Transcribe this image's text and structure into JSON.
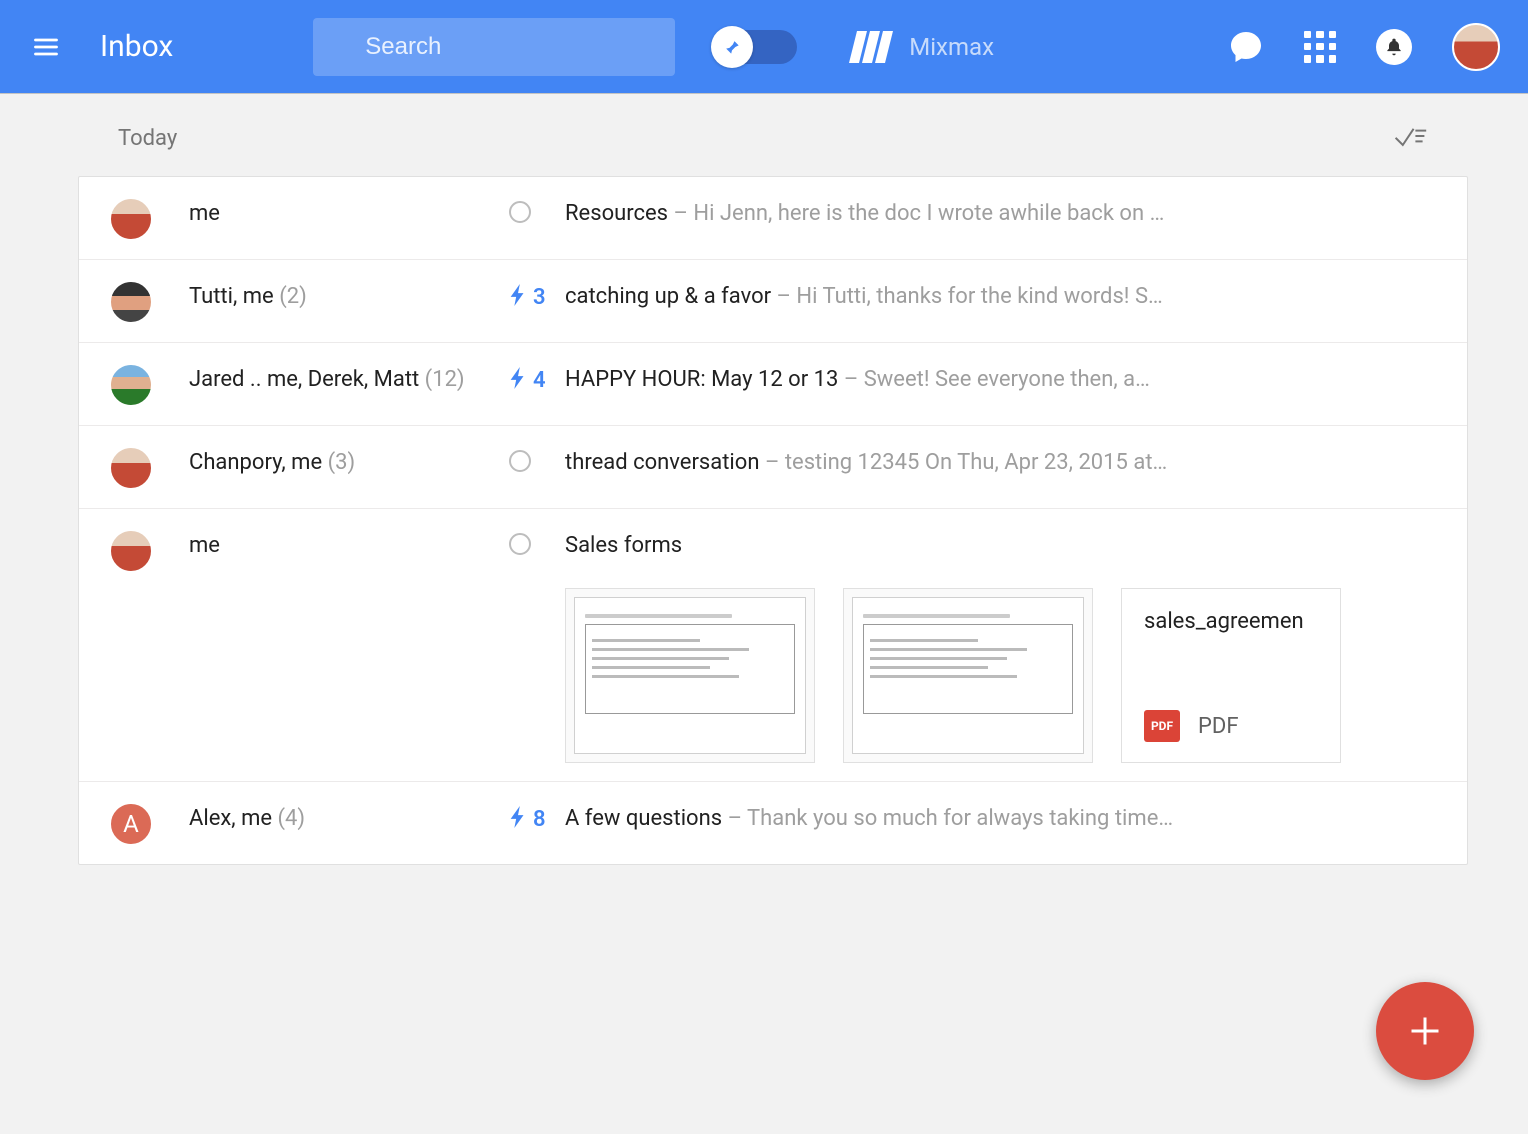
{
  "header": {
    "title": "Inbox",
    "search_placeholder": "Search",
    "mixmax_label": "Mixmax"
  },
  "section": {
    "label": "Today"
  },
  "threads": [
    {
      "sender": "me",
      "count": "",
      "indicator": "circle",
      "subject": "Resources",
      "snippet": " – Hi Jenn, here is the doc I wrote awhile back on …",
      "avatar": "me"
    },
    {
      "sender": "Tutti, me",
      "count": " (2)",
      "indicator": "bolt",
      "bolt_count": "3",
      "subject": "catching up & a favor",
      "snippet": " – Hi Tutti, thanks for the kind words! S…",
      "avatar": "a2"
    },
    {
      "sender": "Jared .. me, Derek, Matt",
      "count": " (12)",
      "indicator": "bolt",
      "bolt_count": "4",
      "subject": "HAPPY HOUR: May 12 or 13",
      "snippet": " – Sweet! See everyone then, a…",
      "avatar": "a3"
    },
    {
      "sender": "Chanpory, me",
      "count": " (3)",
      "indicator": "circle",
      "subject": "thread conversation",
      "snippet": " – testing 12345 On Thu, Apr 23, 2015 at…",
      "avatar": "me"
    },
    {
      "sender": "me",
      "count": "",
      "indicator": "circle",
      "subject": "Sales forms",
      "snippet": "",
      "avatar": "me",
      "attachments": {
        "file_name": "sales_agreemen",
        "file_type_badge": "PDF",
        "file_type_label": "PDF"
      }
    },
    {
      "sender": "Alex, me",
      "count": " (4)",
      "indicator": "bolt",
      "bolt_count": "8",
      "subject": "A few questions",
      "snippet": " – Thank you so much for always taking time…",
      "avatar": "letter",
      "avatar_letter": "A"
    }
  ]
}
